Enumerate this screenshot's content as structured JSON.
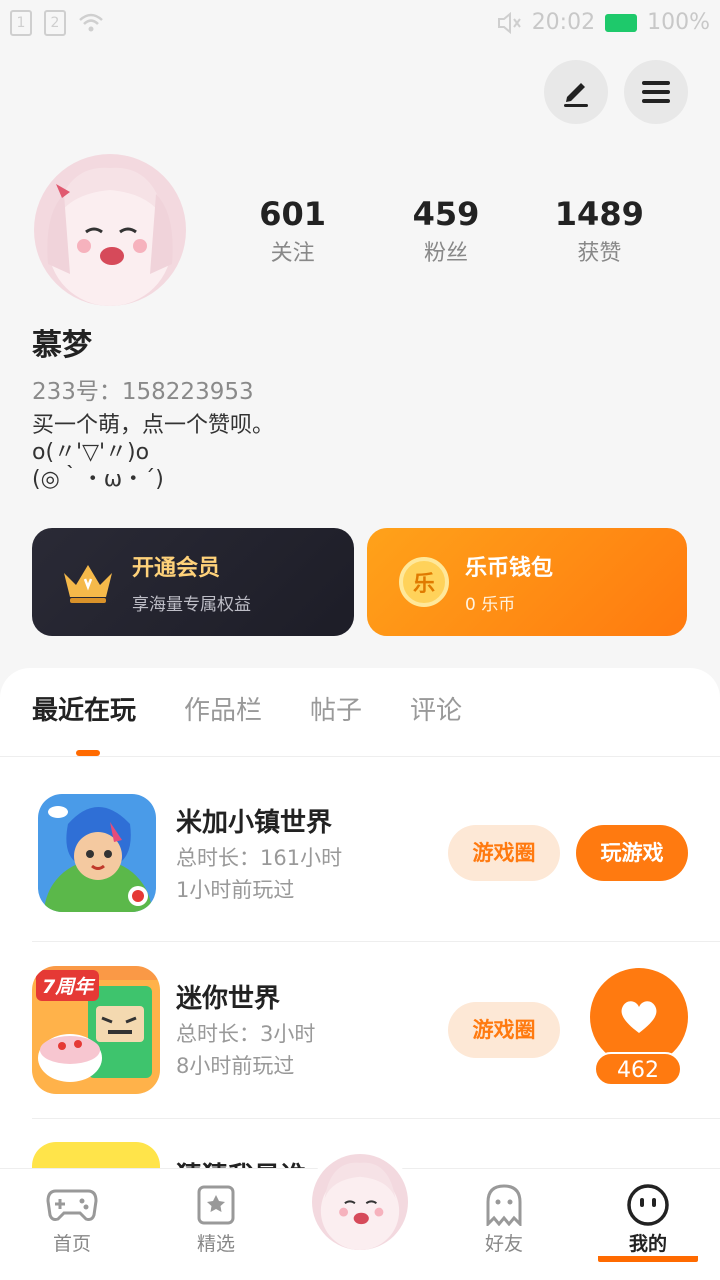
{
  "status_bar": {
    "sim1": "1",
    "sim2": "2",
    "time": "20:02",
    "battery": "100%"
  },
  "profile": {
    "nickname": "慕梦",
    "uid": "233号：158223953",
    "bio": "买一个萌，点一个赞呗。\no(〃'▽'〃)o\n(◎｀・ω・´)",
    "stats": [
      {
        "num": "601",
        "label": "关注"
      },
      {
        "num": "459",
        "label": "粉丝"
      },
      {
        "num": "1489",
        "label": "获赞"
      }
    ]
  },
  "vip_card": {
    "title": "开通会员",
    "subtitle": "享海量专属权益"
  },
  "coin_card": {
    "icon_text": "乐",
    "title": "乐币钱包",
    "subtitle": "0 乐币"
  },
  "tabs": [
    "最近在玩",
    "作品栏",
    "帖子",
    "评论"
  ],
  "games": [
    {
      "name": "米加小镇世界",
      "duration": "总时长：161小时",
      "last_played": "1小时前玩过",
      "circle_btn": "游戏圈",
      "play_btn": "玩游戏"
    },
    {
      "name": "迷你世界",
      "duration": "总时长：3小时",
      "last_played": "8小时前玩过",
      "circle_btn": "游戏圈",
      "badge": "7周年"
    },
    {
      "name": "猜猜我是谁"
    }
  ],
  "like_count": "462",
  "bottom_nav": [
    {
      "label": "首页"
    },
    {
      "label": "精选"
    },
    {
      "label": "好友"
    },
    {
      "label": "我的"
    }
  ],
  "colors": {
    "accent": "#ff7a10",
    "vip_bg": "#23232e",
    "vip_text": "#ffd27a"
  }
}
